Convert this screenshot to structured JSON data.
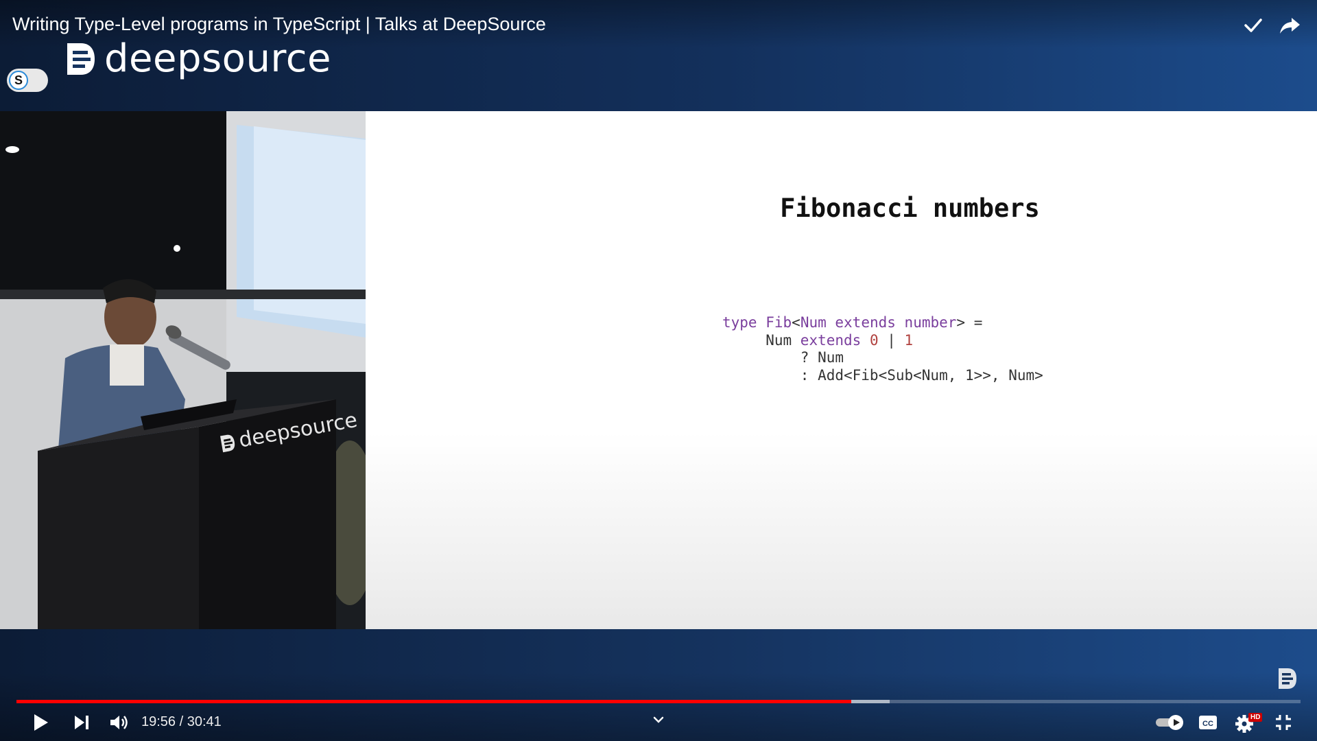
{
  "video": {
    "title": "Writing Type-Level programs in TypeScript | Talks at DeepSource",
    "channel_brand": "deepsource",
    "toggle_letter": "S"
  },
  "slide": {
    "title": "Fibonacci numbers",
    "code": [
      [
        {
          "t": "type ",
          "c": "k"
        },
        {
          "t": "Fib",
          "c": "k"
        },
        {
          "t": "<",
          "c": ""
        },
        {
          "t": "Num ",
          "c": "k"
        },
        {
          "t": "extends ",
          "c": "k"
        },
        {
          "t": "number",
          "c": "k"
        },
        {
          "t": "> =",
          "c": ""
        }
      ],
      [
        {
          "t": "     Num ",
          "c": ""
        },
        {
          "t": "extends ",
          "c": "k"
        },
        {
          "t": "0",
          "c": "n"
        },
        {
          "t": " | ",
          "c": ""
        },
        {
          "t": "1",
          "c": "n"
        }
      ],
      [
        {
          "t": "         ? Num",
          "c": ""
        }
      ],
      [
        {
          "t": "         : Add<Fib<Sub<Num, 1>>, Num>",
          "c": ""
        }
      ]
    ]
  },
  "speaker_cam": {
    "podium_text": "deepsource"
  },
  "player": {
    "time_display": "19:56 / 30:41",
    "current_time": "19:56",
    "duration": "30:41",
    "played_fraction": 0.65,
    "buffered_fraction": 0.68,
    "quality_badge": "HD",
    "progress_color": "#ff0000",
    "icons": {
      "play": "play-icon",
      "next": "next-icon",
      "volume": "volume-icon",
      "chevron": "chevron-down-icon",
      "autoplay": "autoplay-toggle-icon",
      "captions": "captions-icon",
      "settings": "settings-icon",
      "exit_fullscreen": "exit-fullscreen-icon",
      "watch_later": "check-icon",
      "share": "share-icon"
    }
  }
}
